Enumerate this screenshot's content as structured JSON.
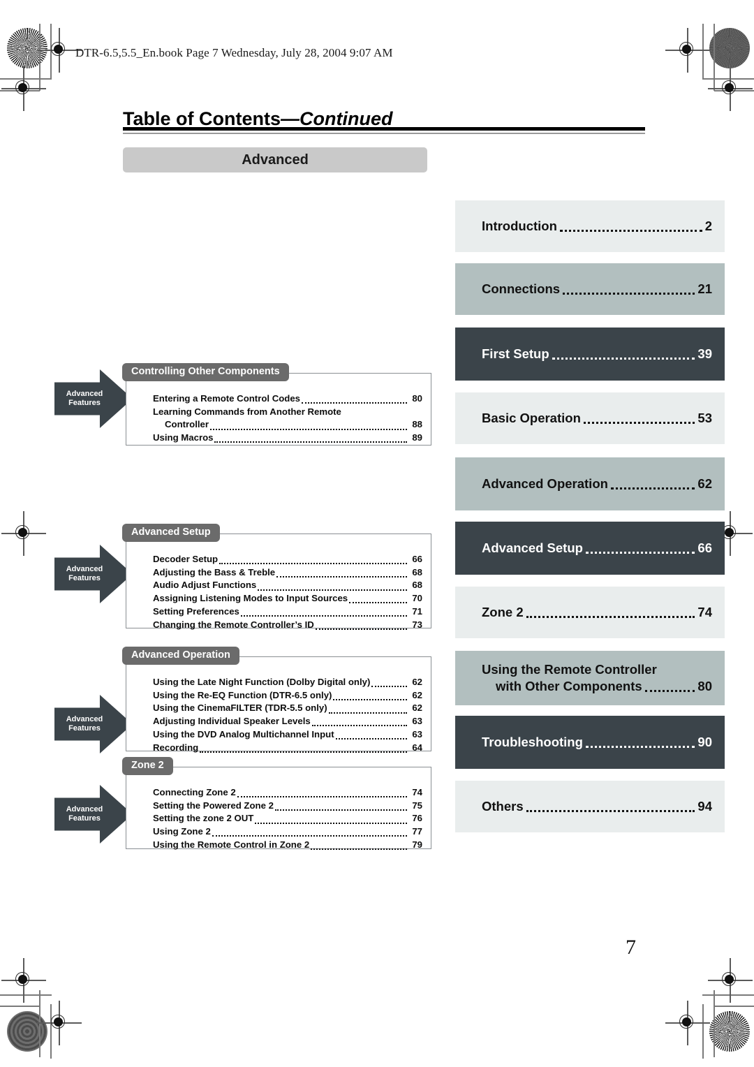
{
  "header": {
    "book_line": "DTR-6.5,5.5_En.book  Page 7  Wednesday, July 28, 2004  9:07 AM"
  },
  "title": {
    "main": "Table of Contents",
    "separator": "—",
    "continued": "Continued"
  },
  "section_banner": {
    "label": "Advanced"
  },
  "arrow_tabs": [
    {
      "line1": "Advanced",
      "line2": "Features"
    },
    {
      "line1": "Advanced",
      "line2": "Features"
    },
    {
      "line1": "Advanced",
      "line2": "Features"
    },
    {
      "line1": "Advanced",
      "line2": "Features"
    }
  ],
  "left_boxes": [
    {
      "label": "Controlling Other Components",
      "entries": [
        {
          "text": "Entering a Remote Control Codes",
          "page": "80",
          "indented": false,
          "leader": true
        },
        {
          "text": "Learning Commands from Another Remote",
          "page": "",
          "indented": false,
          "leader": false
        },
        {
          "text": "Controller",
          "page": "88",
          "indented": true,
          "leader": true
        },
        {
          "text": "Using Macros",
          "page": "89",
          "indented": false,
          "leader": true
        }
      ]
    },
    {
      "label": "Advanced Setup",
      "entries": [
        {
          "text": "Decoder Setup",
          "page": "66",
          "indented": false,
          "leader": true
        },
        {
          "text": "Adjusting the Bass & Treble",
          "page": "68",
          "indented": false,
          "leader": true
        },
        {
          "text": "Audio Adjust Functions",
          "page": "68",
          "indented": false,
          "leader": true
        },
        {
          "text": "Assigning Listening Modes to Input Sources",
          "page": "70",
          "indented": false,
          "leader": true
        },
        {
          "text": "Setting Preferences",
          "page": "71",
          "indented": false,
          "leader": true
        },
        {
          "text": "Changing the Remote Controller’s ID",
          "page": "73",
          "indented": false,
          "leader": true
        }
      ]
    },
    {
      "label": "Advanced Operation",
      "entries": [
        {
          "text": "Using the Late Night Function (Dolby Digital only)",
          "page": "62",
          "indented": false,
          "leader": true
        },
        {
          "text": "Using the Re-EQ Function (DTR-6.5 only)",
          "page": "62",
          "indented": false,
          "leader": true
        },
        {
          "text": "Using the CinemaFILTER (TDR-5.5 only)",
          "page": "62",
          "indented": false,
          "leader": true
        },
        {
          "text": "Adjusting Individual Speaker Levels",
          "page": "63",
          "indented": false,
          "leader": true
        },
        {
          "text": "Using the DVD Analog Multichannel Input",
          "page": "63",
          "indented": false,
          "leader": true
        },
        {
          "text": "Recording",
          "page": "64",
          "indented": false,
          "leader": true
        }
      ]
    },
    {
      "label": "Zone 2",
      "entries": [
        {
          "text": "Connecting Zone 2",
          "page": "74",
          "indented": false,
          "leader": true
        },
        {
          "text": "Setting the Powered Zone 2",
          "page": "75",
          "indented": false,
          "leader": true
        },
        {
          "text": "Setting the zone 2 OUT",
          "page": "76",
          "indented": false,
          "leader": true
        },
        {
          "text": "Using Zone 2",
          "page": "77",
          "indented": false,
          "leader": true
        },
        {
          "text": "Using the Remote Control in Zone 2",
          "page": "79",
          "indented": false,
          "leader": true
        }
      ]
    }
  ],
  "nav_blocks": [
    {
      "label": "Introduction",
      "page": "2",
      "tone": "light",
      "label2": ""
    },
    {
      "label": "Connections",
      "page": "21",
      "tone": "mid",
      "label2": ""
    },
    {
      "label": "First Setup",
      "page": "39",
      "tone": "dark",
      "label2": ""
    },
    {
      "label": "Basic Operation",
      "page": "53",
      "tone": "light",
      "label2": ""
    },
    {
      "label": "Advanced Operation",
      "page": "62",
      "tone": "mid",
      "label2": ""
    },
    {
      "label": "Advanced Setup",
      "page": "66",
      "tone": "dark",
      "label2": ""
    },
    {
      "label": "Zone 2",
      "page": "74",
      "tone": "light",
      "label2": ""
    },
    {
      "label": "Using the Remote Controller",
      "page": "80",
      "tone": "mid",
      "label2": "with Other Components"
    },
    {
      "label": "Troubleshooting",
      "page": "90",
      "tone": "dark",
      "label2": ""
    },
    {
      "label": "Others",
      "page": "94",
      "tone": "light",
      "label2": ""
    }
  ],
  "folio": {
    "page_number": "7"
  },
  "colors": {
    "tone_light": "#e9eded",
    "tone_mid": "#b2bfbf",
    "tone_dark": "#3b444a",
    "banner_gray": "#c9c9c9",
    "tab_gray": "#6b6b6b",
    "box_border": "#8a8f93"
  }
}
